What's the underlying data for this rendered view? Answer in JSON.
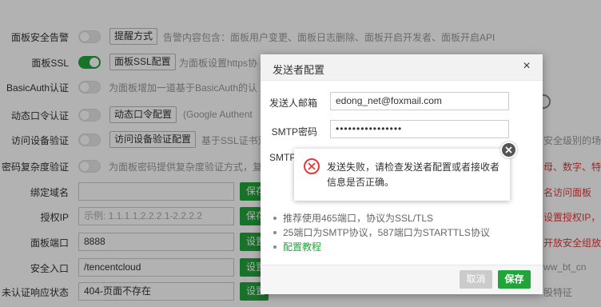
{
  "settings": {
    "rows": [
      {
        "label": "面板安全告警",
        "button": "提醒方式",
        "desc": "告警内容包含：面板用户变更、面板日志删除、面板开启开发者、面板开启API"
      },
      {
        "label": "面板SSL",
        "button": "面板SSL配置",
        "desc": "为面板设置https协"
      },
      {
        "label": "BasicAuth认证",
        "desc": "为面板增加一道基于BasicAuth的认"
      },
      {
        "label": "动态口令认证",
        "button": "动态口令配置",
        "desc": "(Google Authent"
      },
      {
        "label": "访问设备验证",
        "button": "访问设备验证配置",
        "desc": "基于SSL证书双",
        "right_note": "安全级别的场"
      },
      {
        "label": "密码复杂度验证",
        "desc": "为面板密码提供复杂度验证方式，复",
        "right_note": "母、数字、特"
      },
      {
        "label": "绑定域名",
        "input_value": "",
        "action": "保存",
        "right_note": "名访问面板"
      },
      {
        "label": "授权IP",
        "input_placeholder": "示例: 1.1.1.1,2.2.2.1-2.2.2.2",
        "action": "保存",
        "right_note": "设置授权IP，"
      },
      {
        "label": "面板端口",
        "input_value": "8888",
        "action": "设置",
        "right_note": "开放安全组放行"
      },
      {
        "label": "安全入口",
        "input_value": "/tencentcloud",
        "action": "设置",
        "right_note": "ww_bt_cn"
      },
      {
        "label": "未认证响应状态",
        "input_value": "404-页面不存在",
        "action": "设置",
        "right_note": "股特征"
      }
    ]
  },
  "dialog": {
    "title": "发送者配置",
    "close_symbol": "×",
    "fields": [
      {
        "label": "发送人邮箱",
        "value": "edong_net@foxmail.com"
      },
      {
        "label": "SMTP密码",
        "value": "••••••••••••••••"
      },
      {
        "label": "SMTP"
      }
    ],
    "tips": [
      "推荐使用465端口，协议为SSL/TLS",
      "25端口为SMTP协议，587端口为STARTTLS协议",
      "配置教程"
    ],
    "cancel_label": "取消",
    "save_label": "保存"
  },
  "toast": {
    "message": "发送失败，请检查发送者配置或者接收者信息是否正确。",
    "icon": "error-circle-icon"
  },
  "colors": {
    "accent": "#20a53a",
    "error": "#e4393c",
    "overlay": "rgba(0,0,0,0.3)"
  }
}
